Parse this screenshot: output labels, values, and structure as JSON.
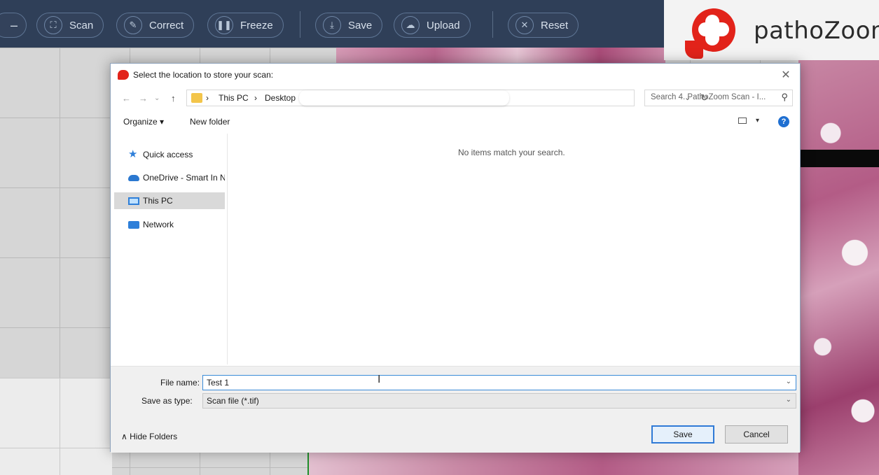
{
  "toolbar": {
    "buttons": [
      {
        "label": "Scan",
        "icon": "scan-icon"
      },
      {
        "label": "Correct",
        "icon": "edit-icon"
      },
      {
        "label": "Freeze",
        "icon": "pause-icon"
      },
      {
        "label": "Save",
        "icon": "save-icon"
      },
      {
        "label": "Upload",
        "icon": "upload-icon"
      },
      {
        "label": "Reset",
        "icon": "close-circle-icon"
      }
    ],
    "brand": "pathoZoom"
  },
  "dialog": {
    "title": "Select the location to store your scan:",
    "breadcrumb": [
      "This PC",
      "Desktop"
    ],
    "search_placeholder": "Search 4. PathoZoom Scan - I...",
    "commands": {
      "organize": "Organize ▾",
      "new_folder": "New folder"
    },
    "nav_items": [
      "Quick access",
      "OneDrive - Smart In N",
      "This PC",
      "Network"
    ],
    "selected_nav": "This PC",
    "empty_message": "No items match your search.",
    "file_name_label": "File name:",
    "file_name_value": "Test 1",
    "save_type_label": "Save as type:",
    "save_type_value": "Scan file (*.tif)",
    "hide_folders": "Hide Folders",
    "save_button": "Save",
    "cancel_button": "Cancel"
  },
  "colors": {
    "toolbar_bg": "#2f3f58",
    "brand_red": "#e2231a",
    "accent_blue": "#2f7ad6"
  }
}
